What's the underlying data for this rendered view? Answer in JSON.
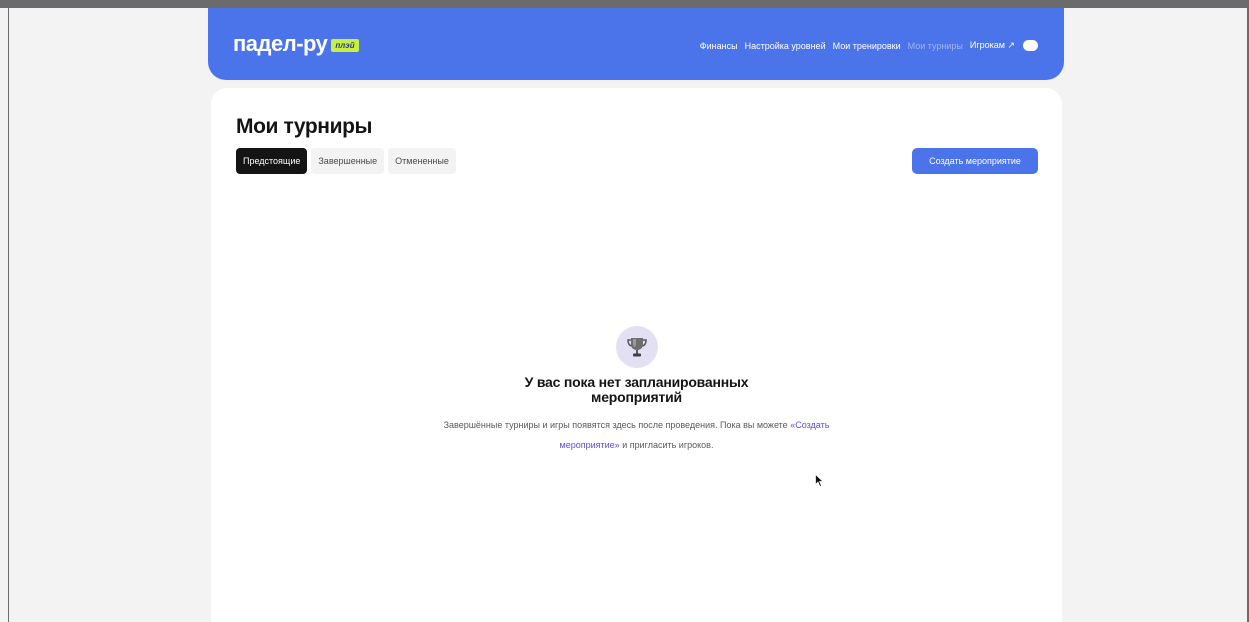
{
  "header": {
    "logo_text": "падел-ру",
    "logo_badge": "плэй",
    "nav": [
      {
        "label": "Финансы",
        "active": false
      },
      {
        "label": "Настройка уровней",
        "active": false
      },
      {
        "label": "Мои тренировки",
        "active": false
      },
      {
        "label": "Мои турниры",
        "active": true
      },
      {
        "label": "Игрокам ↗",
        "active": false
      }
    ],
    "toggle_icon": "toggle-icon"
  },
  "page": {
    "title": "Мои турниры",
    "tabs": [
      {
        "label": "Предстоящие",
        "active": true
      },
      {
        "label": "Завершенные",
        "active": false
      },
      {
        "label": "Отмененные",
        "active": false
      }
    ],
    "create_button": "Создать мероприятие"
  },
  "empty_state": {
    "icon": "trophy-icon",
    "title": "У вас пока нет запланированных мероприятий",
    "desc_before": "Завершённые турниры и игры появятся здесь после проведения. Пока вы можете ",
    "desc_link": "«Создать мероприятие»",
    "desc_after": " и пригласить игроков."
  },
  "colors": {
    "accent": "#4b74ea",
    "badge": "#c8f03c",
    "active_tab": "#141414",
    "link": "#5b4fd9"
  }
}
